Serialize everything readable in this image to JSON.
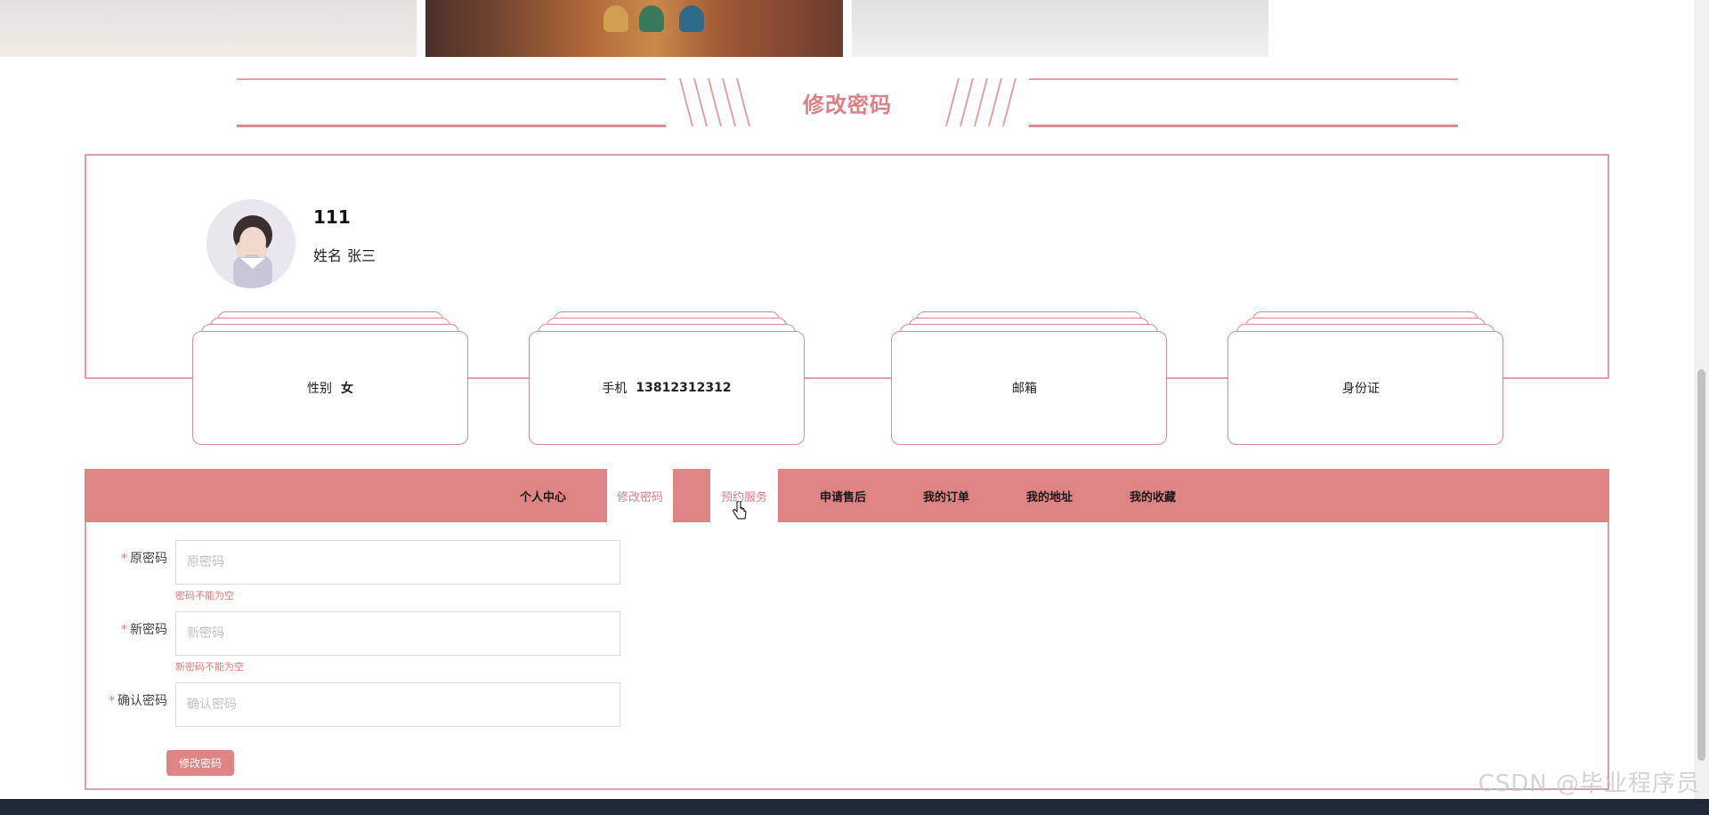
{
  "section_title": "修改密码",
  "profile": {
    "username": "111",
    "name_label": "姓名",
    "name_value": "张三"
  },
  "cards": [
    {
      "label": "性别",
      "value": "女"
    },
    {
      "label": "手机",
      "value": "13812312312"
    },
    {
      "label": "邮箱",
      "value": ""
    },
    {
      "label": "身份证",
      "value": ""
    }
  ],
  "tabs": [
    {
      "label": "个人中心"
    },
    {
      "label": "修改密码"
    },
    {
      "label": "预约服务"
    },
    {
      "label": "申请售后"
    },
    {
      "label": "我的订单"
    },
    {
      "label": "我的地址"
    },
    {
      "label": "我的收藏"
    }
  ],
  "form": {
    "fields": [
      {
        "label": "原密码",
        "placeholder": "原密码",
        "value": "",
        "error": "密码不能为空"
      },
      {
        "label": "新密码",
        "placeholder": "新密码",
        "value": "",
        "error": "新密码不能为空"
      },
      {
        "label": "确认密码",
        "placeholder": "确认密码",
        "value": "",
        "error": ""
      }
    ],
    "required_mark": "*",
    "submit_label": "修改密码"
  },
  "watermark": "CSDN @毕业程序员",
  "colors": {
    "accent": "#df8484",
    "title": "#d98185",
    "border": "#e09ea3",
    "error": "#e07a7a"
  }
}
